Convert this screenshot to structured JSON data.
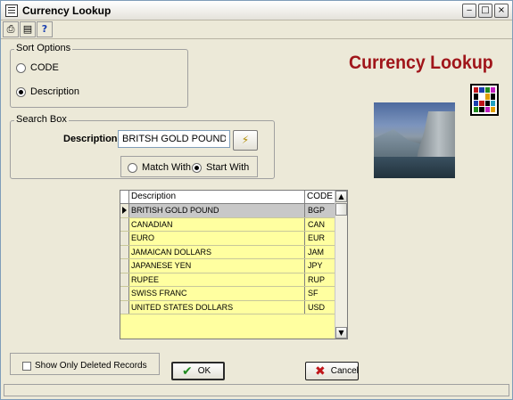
{
  "window": {
    "title": "Currency Lookup"
  },
  "title_buttons": {
    "minimize": "‒",
    "maximize": "□",
    "close": "×"
  },
  "toolbar": {
    "print_icon": "print-icon",
    "report_icon": "report-icon",
    "help_label": "?"
  },
  "sort_options": {
    "legend": "Sort Options",
    "options": [
      {
        "label": "CODE",
        "selected": false
      },
      {
        "label": "Description",
        "selected": true
      }
    ]
  },
  "brand": {
    "title": "Currency Lookup"
  },
  "search_box": {
    "legend": "Search Box",
    "field_label": "Description",
    "value": "BRITSH GOLD POUND",
    "modes": [
      {
        "label": "Match With",
        "selected": false
      },
      {
        "label": "Start With",
        "selected": true
      }
    ]
  },
  "grid": {
    "columns": [
      "Description",
      "CODE"
    ],
    "rows": [
      {
        "description": "BRITISH GOLD POUND",
        "code": "BGP",
        "selected": true
      },
      {
        "description": "CANADIAN",
        "code": "CAN",
        "selected": false
      },
      {
        "description": "EURO",
        "code": "EUR",
        "selected": false
      },
      {
        "description": "JAMAICAN DOLLARS",
        "code": "JAM",
        "selected": false
      },
      {
        "description": "JAPANESE YEN",
        "code": "JPY",
        "selected": false
      },
      {
        "description": "RUPEE",
        "code": "RUP",
        "selected": false
      },
      {
        "description": "SWISS FRANC",
        "code": "SF",
        "selected": false
      },
      {
        "description": "UNITED STATES DOLLARS",
        "code": "USD",
        "selected": false
      }
    ]
  },
  "footer": {
    "show_deleted_label": "Show Only Deleted Records",
    "show_deleted_checked": false,
    "ok_label": "OK",
    "cancel_label": "Cancel"
  },
  "colors": {
    "brand": "#a0151a",
    "grid_bg": "#ffffa0",
    "selected_row": "#c8c8c8"
  }
}
